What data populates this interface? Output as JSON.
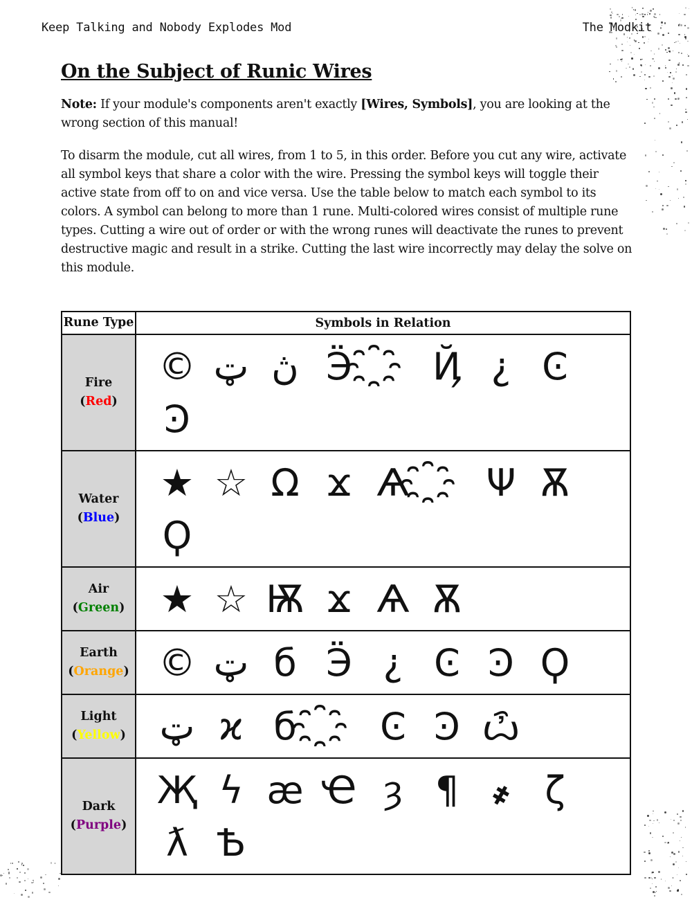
{
  "header": {
    "left": "Keep Talking and Nobody Explodes Mod",
    "right": "The Modkit"
  },
  "title": "On the Subject of Runic Wires",
  "note": {
    "label": "Note:",
    "text_before": " If your module's components aren't exactly ",
    "components": "[Wires, Symbols]",
    "text_after": ", you are looking at the wrong section of this manual!"
  },
  "instructions": "To disarm the module, cut all wires, from 1 to 5, in this order. Before you cut any wire, activate all symbol keys that share a color with the wire. Pressing the symbol keys will toggle their active state from off to on and vice versa. Use the table below to match each symbol to its colors. A symbol can belong to more than 1 rune. Multi-colored wires consist of multiple rune types. Cutting a wire out of order or with the wrong runes will deactivate the runes to prevent destructive magic and result in a strike. Cutting the last wire incorrectly may delay the solve on this module.",
  "table": {
    "headers": {
      "type": "Rune Type",
      "symbols": "Symbols in Relation"
    },
    "rows": [
      {
        "name": "Fire",
        "color_name": "Red",
        "color": "#ff0000",
        "symbols": [
          "©",
          "ټ",
          "ڽ",
          "Ӭ",
          "҈",
          "Ҋ",
          "¿",
          "Ͼ",
          "Ͽ"
        ]
      },
      {
        "name": "Water",
        "color_name": "Blue",
        "color": "#0000ff",
        "symbols": [
          "★",
          "☆",
          "Ω",
          "ϫ",
          "Ѧ",
          "҈",
          "Ψ",
          "Ѫ",
          "Ϙ"
        ]
      },
      {
        "name": "Air",
        "color_name": "Green",
        "color": "#008000",
        "symbols": [
          "★",
          "☆",
          "Ѭ",
          "ϫ",
          "Ѧ",
          "Ѫ"
        ]
      },
      {
        "name": "Earth",
        "color_name": "Orange",
        "color": "#ffa500",
        "symbols": [
          "©",
          "ټ",
          "б",
          "Ӭ",
          "¿",
          "Ͼ",
          "Ͽ",
          "Ϙ"
        ]
      },
      {
        "name": "Light",
        "color_name": "Yellow",
        "color": "#ffff00",
        "symbols": [
          "ټ",
          "ϰ",
          "б",
          "҈",
          "Ͼ",
          "Ͽ",
          "ѽ"
        ]
      },
      {
        "name": "Dark",
        "color_name": "Purple",
        "color": "#800080",
        "symbols": [
          "Җ",
          "ϟ",
          "æ",
          "Ҽ",
          "ȝ",
          "¶",
          "҂",
          "ζ",
          "ƛ",
          "Ѣ"
        ]
      }
    ]
  }
}
